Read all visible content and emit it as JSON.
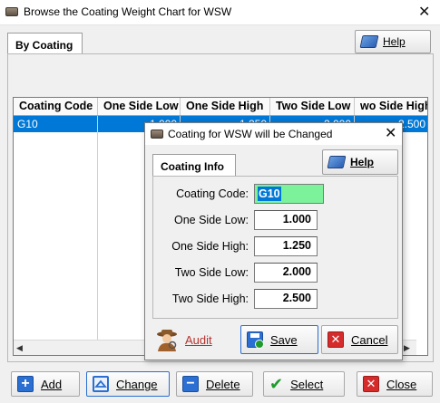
{
  "window": {
    "title": "Browse the Coating Weight Chart for WSW",
    "close_glyph": "✕",
    "tab_label": "By Coating",
    "help_label": "Help"
  },
  "grid": {
    "columns": [
      "Coating Code",
      "One Side Low",
      "One Side High",
      "Two Side Low",
      "wo Side High"
    ],
    "rows": [
      [
        "G10",
        "1.000",
        "1.250",
        "2.000",
        "2.500"
      ]
    ],
    "selection_color": "#0078d7"
  },
  "buttons": {
    "add": "Add",
    "change": "Change",
    "delete": "Delete",
    "select": "Select",
    "close": "Close"
  },
  "dialog": {
    "title": "Coating for WSW will be Changed",
    "close_glyph": "✕",
    "tab_label": "Coating Info",
    "help_label": "Help",
    "fields": {
      "coating_code": {
        "label": "Coating Code:",
        "value": "G10"
      },
      "one_side_low": {
        "label": "One Side Low:",
        "value": "1.000"
      },
      "one_side_high": {
        "label": "One Side High:",
        "value": "1.250"
      },
      "two_side_low": {
        "label": "Two Side Low:",
        "value": "2.000"
      },
      "two_side_high": {
        "label": "Two Side High:",
        "value": "2.500"
      }
    },
    "audit_label": "Audit",
    "save_label": "Save",
    "cancel_label": "Cancel"
  },
  "icons": {
    "window": "app-icon",
    "help": "help-book-icon",
    "add": "plus-icon",
    "change": "triangle-up-icon",
    "delete": "minus-icon",
    "select": "checkmark-icon",
    "close": "x-icon",
    "audit": "detective-icon",
    "save": "save-icon",
    "cancel": "x-icon"
  },
  "colors": {
    "accent": "#0078d7",
    "code_field_bg": "#7cf29a",
    "icon_blue": "#2a6fd1",
    "icon_red": "#d62b2b",
    "icon_green": "#1f9a2b"
  }
}
